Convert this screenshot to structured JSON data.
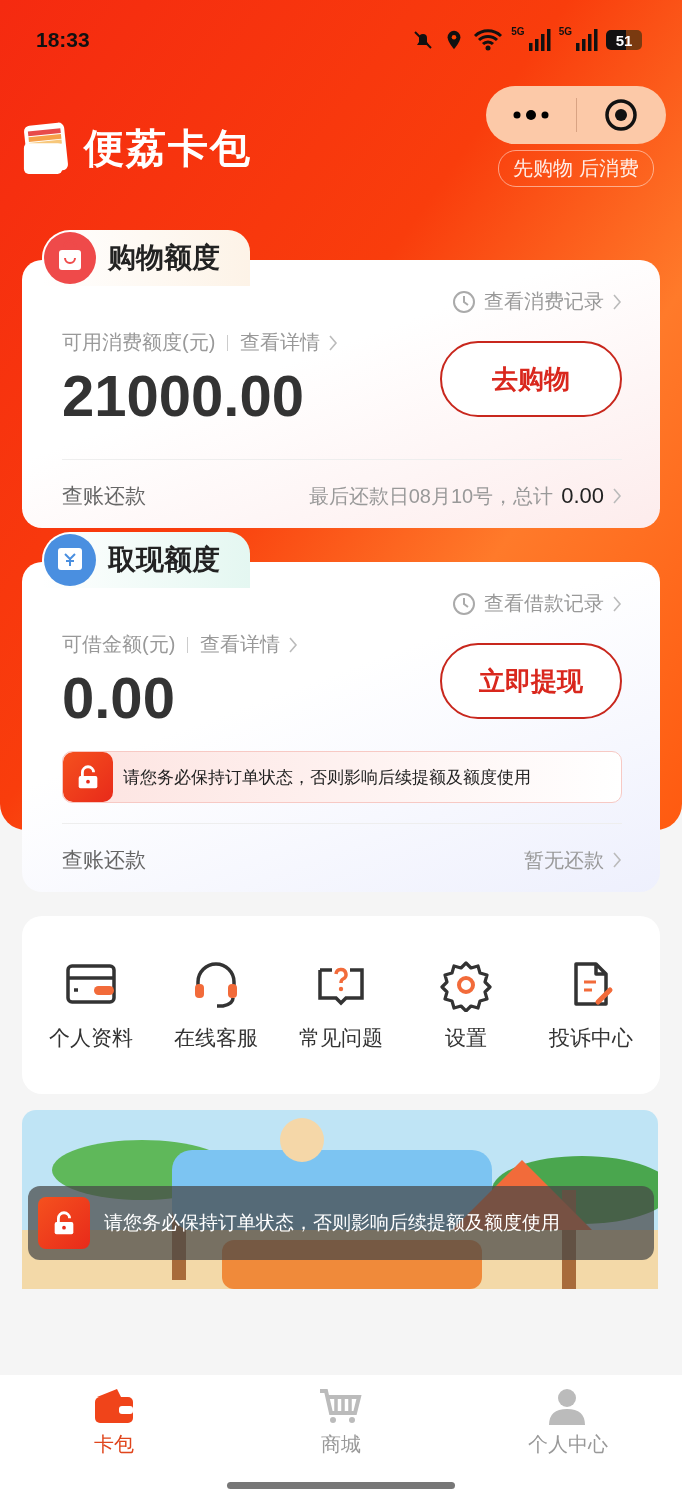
{
  "status_bar": {
    "time": "18:33",
    "network": [
      "5G",
      "5G"
    ],
    "battery": "51"
  },
  "header": {
    "title": "便荔卡包",
    "slogan": "先购物 后消费"
  },
  "cards": [
    {
      "kind": "shopping",
      "tab": "购物额度",
      "record_link": "查看消费记录",
      "amount_label": "可用消费额度(元)",
      "details_link": "查看详情",
      "amount": "21000.00",
      "action": "去购物",
      "repay_label": "查账还款",
      "repay_info": "最后还款日08月10号，总计",
      "repay_total": "0.00"
    },
    {
      "kind": "cash",
      "tab": "取现额度",
      "record_link": "查看借款记录",
      "amount_label": "可借金额(元)",
      "details_link": "查看详情",
      "amount": "0.00",
      "action": "立即提现",
      "notice": "请您务必保持订单状态，否则影响后续提额及额度使用",
      "repay_label": "查账还款",
      "repay_info": "暂无还款"
    }
  ],
  "menu": [
    {
      "label": "个人资料"
    },
    {
      "label": "在线客服"
    },
    {
      "label": "常见问题"
    },
    {
      "label": "设置"
    },
    {
      "label": "投诉中心"
    }
  ],
  "toast": {
    "text": "请您务必保持订单状态，否则影响后续提额及额度使用"
  },
  "tabs": [
    {
      "label": "卡包",
      "selected": true
    },
    {
      "label": "商城",
      "selected": false
    },
    {
      "label": "个人中心",
      "selected": false
    }
  ]
}
